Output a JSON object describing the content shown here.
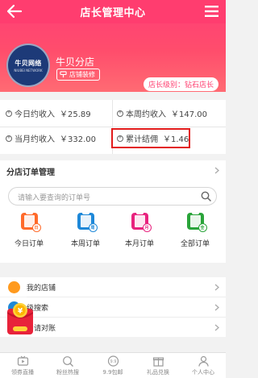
{
  "header": {
    "title": "店长管理中心"
  },
  "hero": {
    "logo_text": "牛贝网络",
    "logo_sub": "NIUBEI NETWORK",
    "shop_name": "牛贝分店",
    "decor_label": "店铺装修",
    "level_label": "店长级别：钻石店长"
  },
  "stats": {
    "today": {
      "label": "今日约收入",
      "amount": "￥25.89",
      "icon": "yuan-icon"
    },
    "week": {
      "label": "本周约收入",
      "amount": "￥147.00",
      "icon": "yuan-icon"
    },
    "month": {
      "label": "当月约收入",
      "amount": "￥332.00",
      "icon": "yuan-icon"
    },
    "total": {
      "label": "累计结佣",
      "amount": "￥1.46",
      "icon": "yuan-icon"
    }
  },
  "orders": {
    "title": "分店订单管理",
    "search_placeholder": "请输入要查询的订单号",
    "items": [
      {
        "label": "今日订单",
        "color": "#ff6a2a",
        "badge": "日"
      },
      {
        "label": "本周订单",
        "color": "#1e88d8",
        "badge": "周"
      },
      {
        "label": "本月订单",
        "color": "#e8237e",
        "badge": "月"
      },
      {
        "label": "全部订单",
        "color": "#2aa43a",
        "badge": "全"
      }
    ]
  },
  "menu": {
    "items": [
      {
        "label": "我的店铺",
        "color": "#ff9a1e"
      },
      {
        "label": "级搜索",
        "color": "#1e88d8"
      },
      {
        "label": "申请对账",
        "color": "#2aa43a"
      }
    ]
  },
  "tabbar": {
    "items": [
      {
        "label": "领券直播",
        "icon": "live-icon"
      },
      {
        "label": "粉丝热搜",
        "icon": "hot-search-icon"
      },
      {
        "label": "9.9包邮",
        "icon": "nine-nine-icon"
      },
      {
        "label": "礼品兑换",
        "icon": "gift-icon"
      },
      {
        "label": "个人中心",
        "icon": "user-icon"
      }
    ]
  },
  "colors": {
    "brand": "#ff3d6f",
    "highlight_border": "#e21b1b"
  }
}
